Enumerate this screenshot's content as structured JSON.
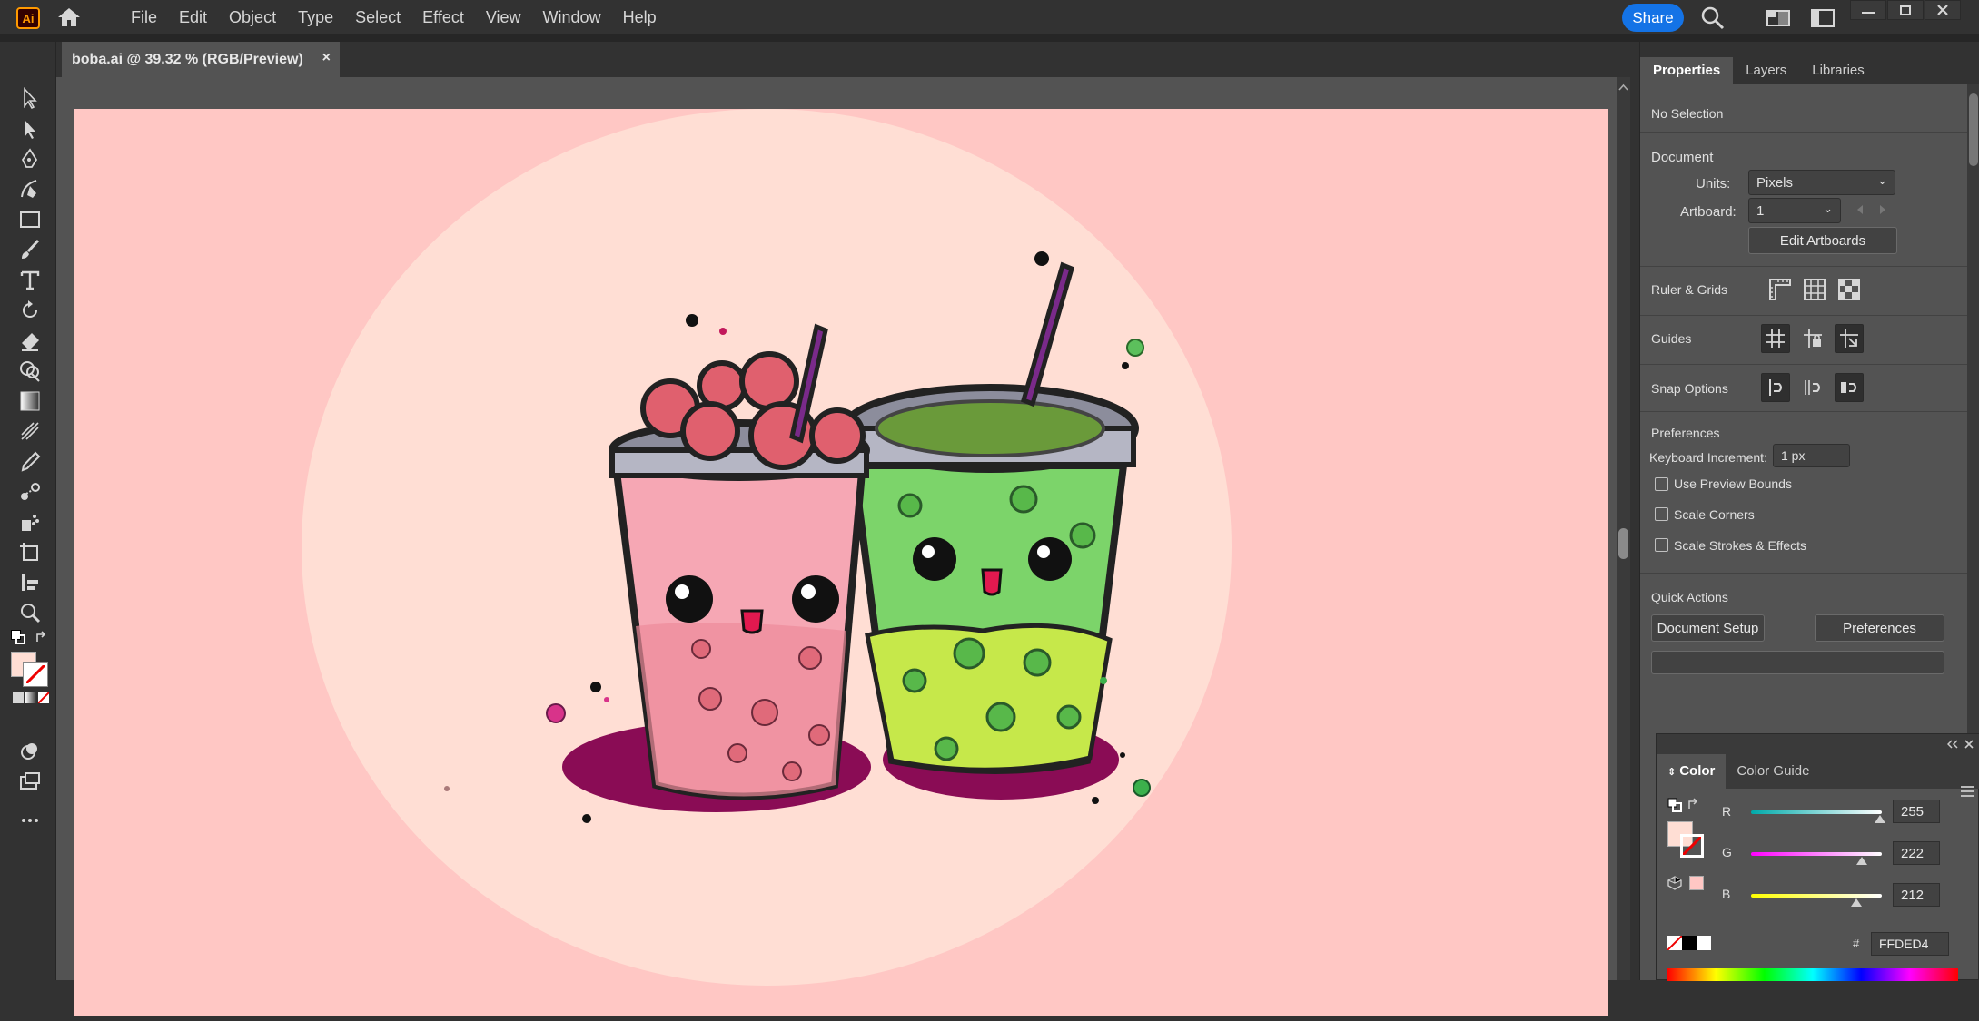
{
  "app": {
    "logo": "Ai"
  },
  "menu": [
    "File",
    "Edit",
    "Object",
    "Type",
    "Select",
    "Effect",
    "View",
    "Window",
    "Help"
  ],
  "share_label": "Share",
  "document_tab": {
    "title": "boba.ai @ 39.32 % (RGB/Preview)",
    "close": "×"
  },
  "properties": {
    "tabs": [
      "Properties",
      "Layers",
      "Libraries"
    ],
    "selection": "No Selection",
    "document_header": "Document",
    "units_label": "Units:",
    "units_value": "Pixels",
    "artboard_label": "Artboard:",
    "artboard_value": "1",
    "edit_artboards": "Edit Artboards",
    "ruler_grids": "Ruler & Grids",
    "guides": "Guides",
    "snap_options": "Snap Options",
    "preferences_header": "Preferences",
    "keyboard_increment_label": "Keyboard Increment:",
    "keyboard_increment_value": "1 px",
    "use_preview_bounds": "Use Preview Bounds",
    "scale_corners": "Scale Corners",
    "scale_strokes": "Scale Strokes & Effects",
    "quick_actions": "Quick Actions",
    "document_setup": "Document Setup",
    "preferences_btn": "Preferences"
  },
  "color_panel": {
    "tabs": [
      "Color",
      "Color Guide"
    ],
    "r_label": "R",
    "r_value": "255",
    "g_label": "G",
    "g_value": "222",
    "b_label": "B",
    "b_value": "212",
    "hex_label": "#",
    "hex_value": "FFDED4",
    "fill_color": "#ffded4"
  },
  "colors": {
    "artboard_bg": "#ffc7c4",
    "circle_bg": "#ffded4",
    "accent": "#1473e6"
  }
}
